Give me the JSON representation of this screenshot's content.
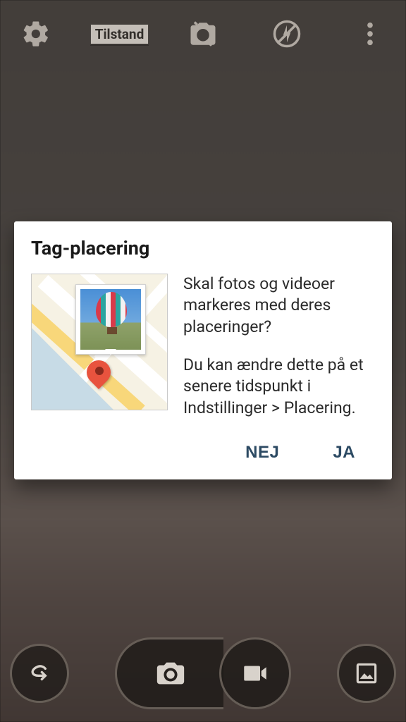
{
  "toolbar": {
    "mode_label": "Tilstand"
  },
  "dialog": {
    "title": "Tag-placering",
    "question": "Skal fotos og videoer markeres med deres placeringer?",
    "hint": "Du kan ændre dette på et senere tidspunkt i Indstillinger > Placering.",
    "no": "NEJ",
    "yes": "JA"
  }
}
